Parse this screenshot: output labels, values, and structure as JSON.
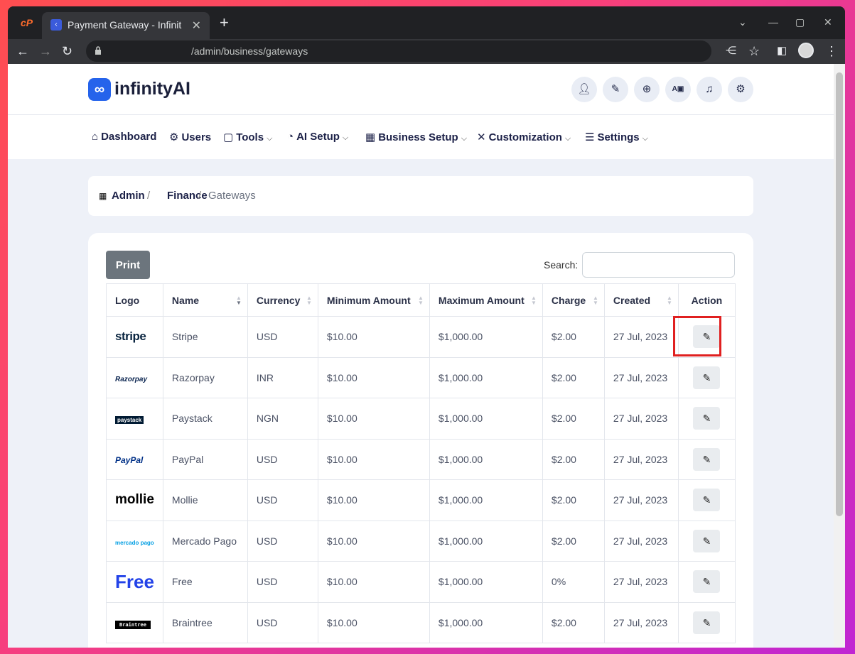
{
  "browser": {
    "tab_title": "Payment Gateway - Infinit",
    "url": "/admin/business/gateways"
  },
  "brand": {
    "mark": "∞",
    "name": "infinityAI"
  },
  "header_icons": [
    "user-icon",
    "broom-icon",
    "globe-icon",
    "ad-icon",
    "bell-icon",
    "user-gear-icon"
  ],
  "nav": [
    {
      "label": "Dashboard",
      "icon": "home-icon",
      "glyph": "⌂",
      "dropdown": false
    },
    {
      "label": "Users",
      "icon": "users-icon",
      "glyph": "⚙",
      "dropdown": false
    },
    {
      "label": "Tools",
      "icon": "briefcase-icon",
      "glyph": "▢",
      "dropdown": true
    },
    {
      "label": "AI Setup",
      "icon": "gauge-icon",
      "glyph": "◔",
      "dropdown": true
    },
    {
      "label": "Business Setup",
      "icon": "building-icon",
      "glyph": "▦",
      "dropdown": true
    },
    {
      "label": "Customization",
      "icon": "tools-icon",
      "glyph": "✕",
      "dropdown": true
    },
    {
      "label": "Settings",
      "icon": "sliders-icon",
      "glyph": "☰",
      "dropdown": true
    }
  ],
  "breadcrumb": {
    "root": "Admin",
    "parent": "Finance",
    "current": "Gateways",
    "sep": "/"
  },
  "toolbar": {
    "print_label": "Print",
    "search_label": "Search:"
  },
  "table": {
    "columns": [
      "Logo",
      "Name",
      "Currency",
      "Minimum Amount",
      "Maximum Amount",
      "Charge",
      "Created",
      "Action"
    ],
    "rows": [
      {
        "logo": "stripe",
        "name": "Stripe",
        "currency": "USD",
        "min": "$10.00",
        "max": "$1,000.00",
        "charge": "$2.00",
        "created": "27 Jul, 2023"
      },
      {
        "logo": "Razorpay",
        "name": "Razorpay",
        "currency": "INR",
        "min": "$10.00",
        "max": "$1,000.00",
        "charge": "$2.00",
        "created": "27 Jul, 2023"
      },
      {
        "logo": "paystack",
        "name": "Paystack",
        "currency": "NGN",
        "min": "$10.00",
        "max": "$1,000.00",
        "charge": "$2.00",
        "created": "27 Jul, 2023"
      },
      {
        "logo": "PayPal",
        "name": "PayPal",
        "currency": "USD",
        "min": "$10.00",
        "max": "$1,000.00",
        "charge": "$2.00",
        "created": "27 Jul, 2023"
      },
      {
        "logo": "mollie",
        "name": "Mollie",
        "currency": "USD",
        "min": "$10.00",
        "max": "$1,000.00",
        "charge": "$2.00",
        "created": "27 Jul, 2023"
      },
      {
        "logo": "mercado pago",
        "name": "Mercado Pago",
        "currency": "USD",
        "min": "$10.00",
        "max": "$1,000.00",
        "charge": "$2.00",
        "created": "27 Jul, 2023"
      },
      {
        "logo": "Free",
        "name": "Free",
        "currency": "USD",
        "min": "$10.00",
        "max": "$1,000.00",
        "charge": "0%",
        "created": "27 Jul, 2023"
      },
      {
        "logo": "Braintree",
        "name": "Braintree",
        "currency": "USD",
        "min": "$10.00",
        "max": "$1,000.00",
        "charge": "$2.00",
        "created": "27 Jul, 2023"
      }
    ]
  },
  "colors": {
    "accent": "#2563eb",
    "highlight": "#e02020",
    "print_button": "#6c757d"
  }
}
